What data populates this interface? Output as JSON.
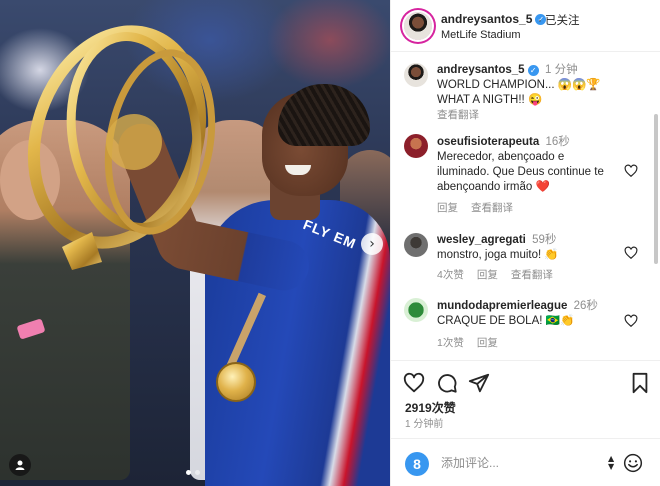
{
  "post": {
    "username": "andreysantos_5",
    "follow_label": "已关注",
    "location": "MetLife Stadium",
    "jersey_text": "FLY EM"
  },
  "caption": {
    "username": "andreysantos_5",
    "time": "1 分钟",
    "line1": "WORLD CHAMPION... 😱😱🏆",
    "line2": "WHAT A NIGTH!! 😜",
    "translate_label": "查看翻译"
  },
  "comments": [
    {
      "username": "oseufisioterapeuta",
      "time": "16秒",
      "line1": "Merecedor, abençoado e",
      "line2": "iluminado. Que Deus continue te",
      "line3": "abençoando irmão ❤️",
      "reply_label": "回复",
      "translate_label": "查看翻译"
    },
    {
      "username": "wesley_agregati",
      "time": "59秒",
      "line1": "monstro, joga muito! 👏",
      "likes_label": "4次赞",
      "reply_label": "回复",
      "translate_label": "查看翻译"
    },
    {
      "username": "mundodapremierleague",
      "time": "26秒",
      "line1": "CRAQUE DE BOLA! 🇧🇷👏",
      "likes_label": "1次赞",
      "reply_label": "回复"
    }
  ],
  "actions": {
    "likes": "2919次赞",
    "posted": "1 分钟前"
  },
  "comment_box": {
    "avatar_letter": "8",
    "placeholder": "添加评论..."
  },
  "colors": {
    "verified": "#3897f0",
    "secondary_text": "#8e8e8e",
    "heart_red": "#ed4956"
  }
}
